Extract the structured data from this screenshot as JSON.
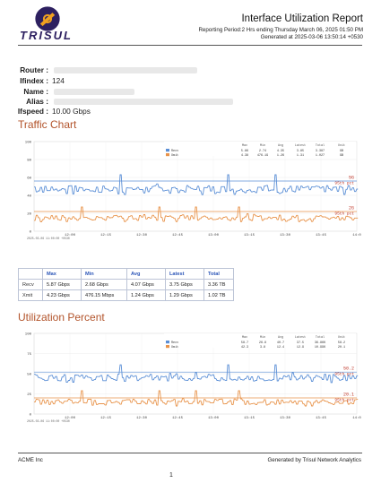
{
  "header": {
    "logo_text": "TRISUL",
    "title": "Interface Utilization Report",
    "period": "Reporting Period:2 Hrs ending Thursday March 06, 2025 01:50 PM",
    "generated": "Generated at 2025-03-06 13:50:14 +0530"
  },
  "info": [
    {
      "key": "Router :",
      "value": ""
    },
    {
      "key": "Ifindex :",
      "value": "124"
    },
    {
      "key": "Name :",
      "value": ""
    },
    {
      "key": "Alias :",
      "value": ""
    },
    {
      "key": "Ifspeed :",
      "value": "10.00 Gbps"
    }
  ],
  "traffic": {
    "section_title": "Traffic Chart",
    "y_ticks": [
      "100",
      "80",
      "60",
      "40",
      "20",
      "0"
    ],
    "x_ticks": [
      "12:00",
      "12:15",
      "12:30",
      "12:45",
      "13:00",
      "13:15",
      "13:30",
      "13:45",
      "14:0"
    ],
    "x_date": "2025-03-06 11:00:00 +0530",
    "legend_header": [
      "Max",
      "Min",
      "Avg",
      "Latest",
      "Total",
      "Unit"
    ],
    "legend_rows": [
      {
        "name": "Recv",
        "color": "#5b8fd6",
        "vals": [
          "5.86",
          "2.74",
          "4.35",
          "3.85",
          "3.387",
          "GB"
        ]
      },
      {
        "name": "Xmit",
        "color": "#e8934a",
        "vals": [
          "4.38",
          "476.19",
          "1.26",
          "1.31",
          "1.027",
          "GB"
        ]
      }
    ],
    "ref_labels": [
      {
        "text": "5G",
        "color": "#c0392b"
      },
      {
        "text": "95th pct",
        "color": "#c0392b"
      },
      {
        "text": "2G",
        "color": "#c0392b"
      },
      {
        "text": "95th pct",
        "color": "#c0392b"
      }
    ]
  },
  "stats_table": {
    "headers": [
      "",
      "Max",
      "Min",
      "Avg",
      "Latest",
      "Total"
    ],
    "rows": [
      [
        "Recv",
        "5.87 Gbps",
        "2.68 Gbps",
        "4.07 Gbps",
        "3.75 Gbps",
        "3.36 TB"
      ],
      [
        "Xmit",
        "4.23 Gbps",
        "476.15 Mbps",
        "1.24 Gbps",
        "1.29 Gbps",
        "1.02 TB"
      ]
    ]
  },
  "util": {
    "section_title": "Utilization Percent",
    "y_ticks": [
      "100",
      "75",
      "50",
      "25",
      "0"
    ],
    "x_ticks": [
      "12:00",
      "12:15",
      "12:30",
      "12:45",
      "13:00",
      "13:15",
      "13:30",
      "13:45",
      "14:0"
    ],
    "x_date": "2025-03-06 11:00:00 +0530",
    "legend_header": [
      "Max",
      "Min",
      "Avg",
      "Latest",
      "Total",
      "Unit"
    ],
    "legend_rows": [
      {
        "name": "Recv",
        "color": "#5b8fd6",
        "vals": [
          "58.7",
          "26.8",
          "40.7",
          "37.5",
          "36.86K",
          "58.2"
        ]
      },
      {
        "name": "Xmit",
        "color": "#e8934a",
        "vals": [
          "42.3",
          "3.8",
          "12.4",
          "12.9",
          "10.99K",
          "20.1"
        ]
      }
    ],
    "ref_labels": [
      {
        "text": "50.2",
        "color": "#c0392b"
      },
      {
        "text": "95th pct",
        "color": "#c0392b"
      },
      {
        "text": "20.1",
        "color": "#c0392b"
      },
      {
        "text": "95th pct",
        "color": "#c0392b"
      }
    ]
  },
  "footer": {
    "left": "ACME Inc",
    "right": "Generated by Trisul Network Analytics",
    "page": "1"
  },
  "colors": {
    "recv": "#5b8fd6",
    "xmit": "#e8934a",
    "accent": "#b2532a"
  },
  "chart_data": [
    {
      "type": "line",
      "series": [
        {
          "name": "Recv"
        },
        {
          "name": "Xmit"
        }
      ],
      "ylim": [
        0,
        100
      ]
    },
    {
      "type": "line",
      "title": "Utilization Percent",
      "series": [
        {
          "name": "Recv"
        },
        {
          "name": "Xmit"
        }
      ],
      "ylim": [
        0,
        100
      ]
    }
  ]
}
